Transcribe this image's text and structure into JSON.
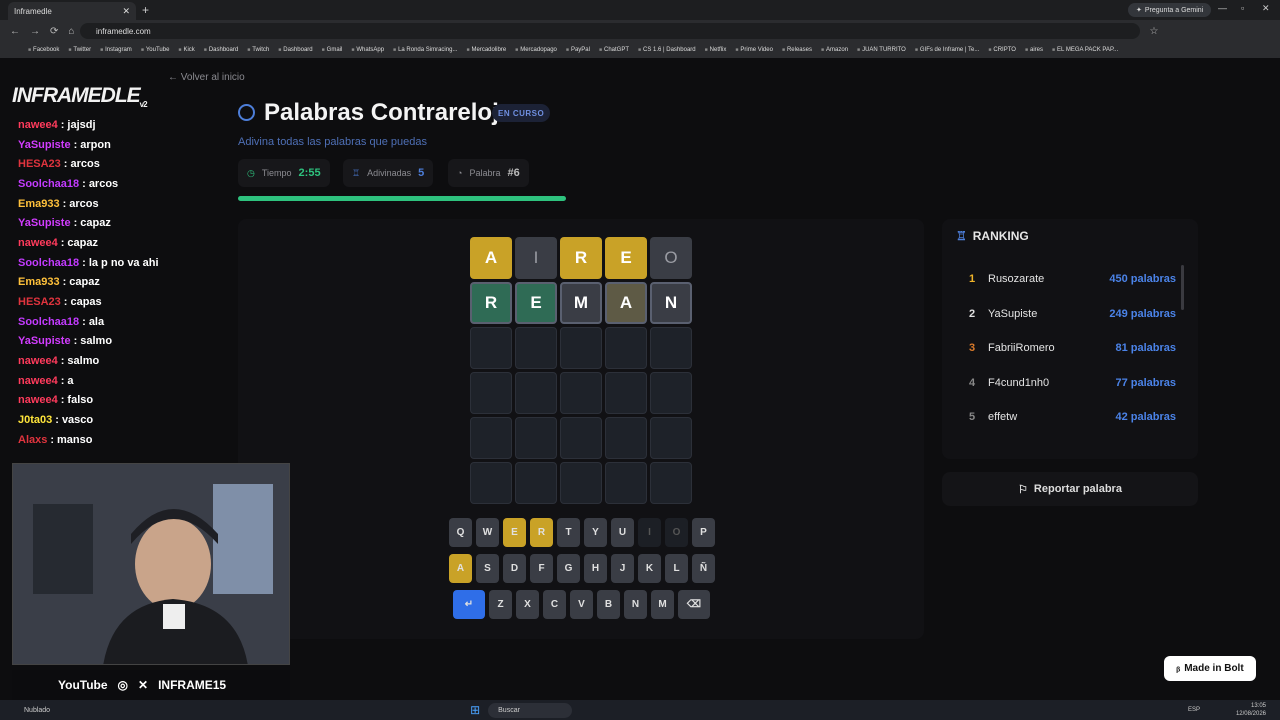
{
  "browser": {
    "tab_title": "Inframedle",
    "url": "inframedle.com",
    "gemini": "Pregunta a Gemini",
    "bookmarks": [
      "Facebook",
      "Twitter",
      "Instagram",
      "YouTube",
      "Kick",
      "Dashboard",
      "Twitch",
      "Dashboard",
      "Gmail",
      "WhatsApp",
      "La Ronda Simracing...",
      "Mercadolibre",
      "Mercadopago",
      "PayPal",
      "ChatGPT",
      "CS 1.6 | Dashboard",
      "Netflix",
      "Prime Video",
      "Releases",
      "Amazon",
      "JUAN TURRITO",
      "GIFs de Inframe | Te...",
      "CRIPTO",
      "aires",
      "EL MEGA PACK PAP..."
    ]
  },
  "page": {
    "back": "Volver al inicio",
    "logo": "INFRAMEDLE",
    "logo_ver": "v2",
    "title": "Palabras Contrareloj",
    "badge": "EN CURSO",
    "subtitle": "Adivina todas las palabras que puedas",
    "stats": {
      "time_label": "Tiempo",
      "time_value": "2:55",
      "guessed_label": "Adivinadas",
      "guessed_value": "5",
      "word_label": "Palabra",
      "word_value": "#6"
    },
    "progress": 0.55
  },
  "board": {
    "rows": [
      [
        {
          "l": "A",
          "s": "present"
        },
        {
          "l": "I",
          "s": "absent"
        },
        {
          "l": "R",
          "s": "present"
        },
        {
          "l": "E",
          "s": "present"
        },
        {
          "l": "O",
          "s": "absent"
        }
      ],
      [
        {
          "l": "R",
          "s": "correct"
        },
        {
          "l": "E",
          "s": "correct"
        },
        {
          "l": "M",
          "s": "absent"
        },
        {
          "l": "A",
          "s": "present-dim"
        },
        {
          "l": "N",
          "s": "absent"
        }
      ]
    ],
    "total_rows": 6
  },
  "keyboard": {
    "rows": [
      [
        "Q",
        "W",
        "E",
        "R",
        "T",
        "Y",
        "U",
        "I",
        "O",
        "P"
      ],
      [
        "A",
        "S",
        "D",
        "F",
        "G",
        "H",
        "J",
        "K",
        "L",
        "Ñ"
      ],
      [
        "↵",
        "Z",
        "X",
        "C",
        "V",
        "B",
        "N",
        "M",
        "⌫"
      ]
    ],
    "present": [
      "E",
      "R",
      "A"
    ],
    "used": [
      "I",
      "O"
    ]
  },
  "ranking": {
    "title": "RANKING",
    "entries": [
      {
        "pos": "1",
        "name": "Rusozarate",
        "pts": "450 palabras"
      },
      {
        "pos": "2",
        "name": "YaSupiste",
        "pts": "249 palabras"
      },
      {
        "pos": "3",
        "name": "FabriiRomero",
        "pts": "81 palabras"
      },
      {
        "pos": "4",
        "name": "F4cund1nh0",
        "pts": "77 palabras"
      },
      {
        "pos": "5",
        "name": "effetw",
        "pts": "42 palabras"
      }
    ]
  },
  "report": "Reportar palabra",
  "bolt": "Made in Bolt",
  "chat": [
    {
      "user": "nawee4",
      "color": "#ff3b5c",
      "text": "jajsdj"
    },
    {
      "user": "YaSupiste",
      "color": "#d23cff",
      "text": "arpon"
    },
    {
      "user": "HESA23",
      "color": "#e0343e",
      "text": "arcos"
    },
    {
      "user": "Soolchaa18",
      "color": "#c33bff",
      "text": "arcos"
    },
    {
      "user": "Ema933",
      "color": "#ffc13b",
      "text": "arcos"
    },
    {
      "user": "YaSupiste",
      "color": "#d23cff",
      "text": "capaz"
    },
    {
      "user": "nawee4",
      "color": "#ff3b5c",
      "text": "capaz"
    },
    {
      "user": "Soolchaa18",
      "color": "#c33bff",
      "text": "la p no va ahi"
    },
    {
      "user": "Ema933",
      "color": "#ffc13b",
      "text": "capaz"
    },
    {
      "user": "HESA23",
      "color": "#e0343e",
      "text": "capas"
    },
    {
      "user": "Soolchaa18",
      "color": "#c33bff",
      "text": "ala"
    },
    {
      "user": "YaSupiste",
      "color": "#d23cff",
      "text": "salmo"
    },
    {
      "user": "nawee4",
      "color": "#ff3b5c",
      "text": "salmo"
    },
    {
      "user": "nawee4",
      "color": "#ff3b5c",
      "text": "a"
    },
    {
      "user": "nawee4",
      "color": "#ff3b5c",
      "text": "falso"
    },
    {
      "user": "J0ta03",
      "color": "#ffe53b",
      "text": "vasco"
    },
    {
      "user": "Alaxs",
      "color": "#e0343e",
      "text": "manso"
    }
  ],
  "stream": {
    "youtube": "YouTube",
    "handle": "INFRAME15"
  },
  "taskbar": {
    "search": "Buscar",
    "weather": "Nublado",
    "time": "13:05",
    "date": "12/08/2026",
    "lang": "ESP"
  }
}
